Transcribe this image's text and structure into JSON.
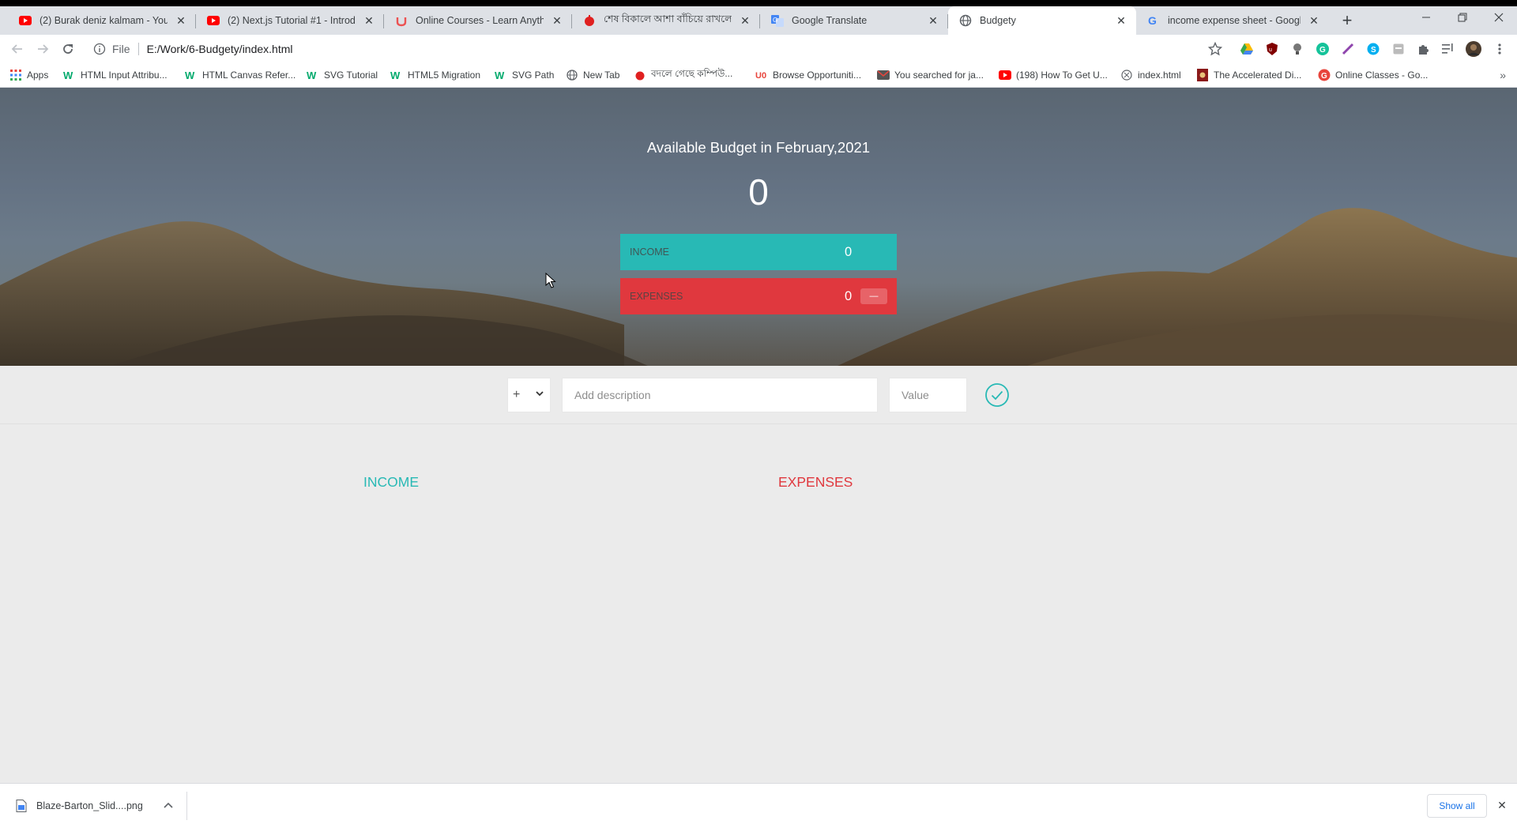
{
  "browser": {
    "tabs": [
      {
        "title": "(2) Burak deniz kalmam - YouTube",
        "favicon": "youtube-icon",
        "active": false
      },
      {
        "title": "(2) Next.js Tutorial #1 - Introduction",
        "favicon": "youtube-icon",
        "active": false
      },
      {
        "title": "Online Courses - Learn Anything, On Your Schedule",
        "favicon": "udemy-icon",
        "active": false
      },
      {
        "title": "শেষ বিকালে আশা বাঁচিয়ে রাখলেন",
        "favicon": "news-icon",
        "active": false
      },
      {
        "title": "Google Translate",
        "favicon": "translate-icon",
        "active": false
      },
      {
        "title": "Budgety",
        "favicon": "globe-icon",
        "active": true
      },
      {
        "title": "income expense sheet - Google Search",
        "favicon": "google-icon",
        "active": false
      }
    ],
    "close_glyph": "✕",
    "new_tab_glyph": "+",
    "address": {
      "scheme_label": "File",
      "url": "E:/Work/6-Budgety/index.html"
    },
    "bookmarks": [
      {
        "label": "Apps",
        "icon": "apps-grid-icon"
      },
      {
        "label": "HTML Input Attribu...",
        "icon": "w3schools-icon"
      },
      {
        "label": "HTML Canvas Refer...",
        "icon": "w3schools-icon"
      },
      {
        "label": "SVG Tutorial",
        "icon": "w3schools-icon"
      },
      {
        "label": "HTML5 Migration",
        "icon": "w3schools-icon"
      },
      {
        "label": "SVG Path",
        "icon": "w3schools-icon"
      },
      {
        "label": "New Tab",
        "icon": "globe-icon"
      },
      {
        "label": "বদলে গেছে কম্পিউ...",
        "icon": "news-icon"
      },
      {
        "label": "Browse Opportuniti...",
        "icon": "upwork-icon"
      },
      {
        "label": "You searched for ja...",
        "icon": "mail-icon"
      },
      {
        "label": "(198) How To Get U...",
        "icon": "youtube-icon"
      },
      {
        "label": "index.html",
        "icon": "file-icon"
      },
      {
        "label": "The Accelerated Di...",
        "icon": "book-icon"
      },
      {
        "label": "Online Classes - Go...",
        "icon": "classes-icon"
      }
    ],
    "bookmarks_overflow": "»"
  },
  "budget": {
    "title": "Available Budget in February,2021",
    "value": "0",
    "income_label": "Income",
    "income_value": "0",
    "expenses_label": "Expenses",
    "expenses_value": "0",
    "expenses_percentage": "—"
  },
  "add_form": {
    "type_value": "+",
    "description_placeholder": "Add description",
    "value_placeholder": "Value"
  },
  "lists": {
    "income_title": "Income",
    "expenses_title": "Expenses"
  },
  "downloads": {
    "file_name": "Blaze-Barton_Slid....png",
    "show_all": "Show all"
  },
  "colors": {
    "income": "#28b9b5",
    "expenses": "#e0383e"
  }
}
